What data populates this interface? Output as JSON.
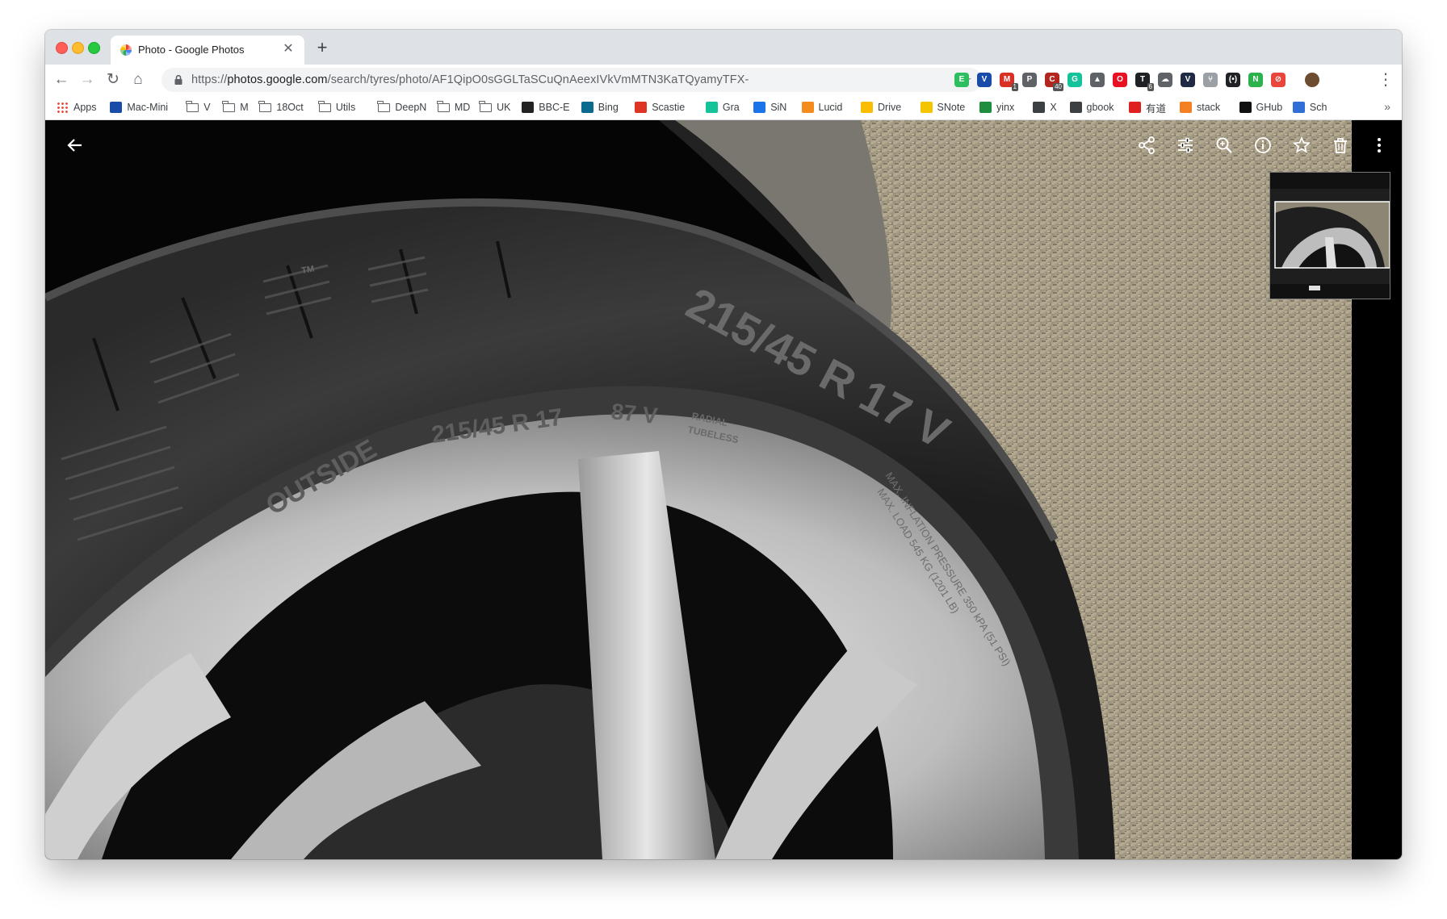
{
  "tab": {
    "title": "Photo - Google Photos",
    "close": "✕",
    "new_tab": "+"
  },
  "toolbar": {
    "back": "←",
    "forward": "→",
    "reload": "↻",
    "home": "⌂",
    "url_prefix": "https://",
    "url_host": "photos.google.com",
    "url_path": "/search/tyres/photo/AF1QipO0sGGLTaSCuQnAeexIVkVmMTN3KaTQyamyTFX-",
    "bookmark_star": "☆",
    "menu": "⋮"
  },
  "extensions": [
    {
      "name": "evernote-icon",
      "glyph": "E",
      "color": "#2dbe60",
      "badge": ""
    },
    {
      "name": "vimium-icon",
      "glyph": "V",
      "color": "#1a4ba8",
      "badge": ""
    },
    {
      "name": "gmail-icon",
      "glyph": "M",
      "color": "#d93025",
      "badge": "1"
    },
    {
      "name": "pocket-icon",
      "glyph": "P",
      "color": "#5f6368",
      "badge": ""
    },
    {
      "name": "calendar-icon",
      "glyph": "C",
      "color": "#b3261e",
      "badge": "40"
    },
    {
      "name": "grammarly-icon",
      "glyph": "G",
      "color": "#15c39a",
      "badge": ""
    },
    {
      "name": "drive-ext-icon",
      "glyph": "▲",
      "color": "#5f6368",
      "badge": ""
    },
    {
      "name": "opera-icon",
      "glyph": "O",
      "color": "#e81123",
      "badge": ""
    },
    {
      "name": "tabs-icon",
      "glyph": "T",
      "color": "#202124",
      "badge": "6"
    },
    {
      "name": "cloud-icon",
      "glyph": "☁",
      "color": "#5f6368",
      "badge": ""
    },
    {
      "name": "v-ext-icon",
      "glyph": "V",
      "color": "#1f2a44",
      "badge": ""
    },
    {
      "name": "fork-icon",
      "glyph": "⑂",
      "color": "#9aa0a6",
      "badge": ""
    },
    {
      "name": "radio-icon",
      "glyph": "(•)",
      "color": "#202124",
      "badge": ""
    },
    {
      "name": "n-ext-icon",
      "glyph": "N",
      "color": "#2bb24c",
      "badge": ""
    },
    {
      "name": "block-icon",
      "glyph": "⊘",
      "color": "#e8453c",
      "badge": ""
    },
    {
      "name": "profile-avatar",
      "glyph": "",
      "color": "#6d4c2f",
      "badge": ""
    }
  ],
  "bookmarks": [
    {
      "label": "Apps",
      "type": "apps"
    },
    {
      "label": "Mac-Mini",
      "type": "icon",
      "color": "#1a4ba8"
    },
    {
      "label": "V",
      "type": "folder"
    },
    {
      "label": "M",
      "type": "folder"
    },
    {
      "label": "18Oct",
      "type": "folder"
    },
    {
      "label": "Utils",
      "type": "folder"
    },
    {
      "label": "DeepN",
      "type": "folder"
    },
    {
      "label": "MD",
      "type": "folder"
    },
    {
      "label": "UK",
      "type": "folder"
    },
    {
      "label": "BBC-E",
      "type": "icon",
      "color": "#222222"
    },
    {
      "label": "Bing",
      "type": "icon",
      "color": "#0b6a8e"
    },
    {
      "label": "Scastie",
      "type": "icon",
      "color": "#de3423"
    },
    {
      "label": "Gra",
      "type": "icon",
      "color": "#15c39a"
    },
    {
      "label": "SiN",
      "type": "icon",
      "color": "#1a73e8"
    },
    {
      "label": "Lucid",
      "type": "icon",
      "color": "#f38b1d"
    },
    {
      "label": "Drive",
      "type": "icon",
      "color": "#fbbc04"
    },
    {
      "label": "SNote",
      "type": "icon",
      "color": "#f5c400"
    },
    {
      "label": "yinx",
      "type": "icon",
      "color": "#1e8e3e"
    },
    {
      "label": "X",
      "type": "icon",
      "color": "#3c4043"
    },
    {
      "label": "gbook",
      "type": "icon",
      "color": "#3c4043"
    },
    {
      "label": "有道",
      "type": "icon",
      "color": "#e02020"
    },
    {
      "label": "stack",
      "type": "icon",
      "color": "#f48024"
    },
    {
      "label": "GHub",
      "type": "icon",
      "color": "#111111"
    },
    {
      "label": "Sch",
      "type": "icon",
      "color": "#2f6fd6"
    }
  ],
  "bookmarks_more": "»",
  "photo": {
    "sidewall_size_large": "215/45 R 17 V",
    "sidewall_outside": "OUTSIDE",
    "sidewall_size_small": "215/45 R 17",
    "sidewall_load": "87 V",
    "sidewall_radial": "RADIAL",
    "sidewall_tubeless": "TUBELESS",
    "sidewall_tm": "TM",
    "sidewall_max_inflation": "MAX. INFLATION PRESSURE 350 kPA (51 PSI)",
    "sidewall_max_load": "MAX. LOAD 545 KG (1201 LB)"
  },
  "viewer_actions": [
    {
      "name": "share-icon"
    },
    {
      "name": "edit-icon"
    },
    {
      "name": "zoom-icon"
    },
    {
      "name": "info-icon"
    },
    {
      "name": "favorite-icon"
    },
    {
      "name": "delete-icon"
    },
    {
      "name": "more-options-icon"
    }
  ]
}
